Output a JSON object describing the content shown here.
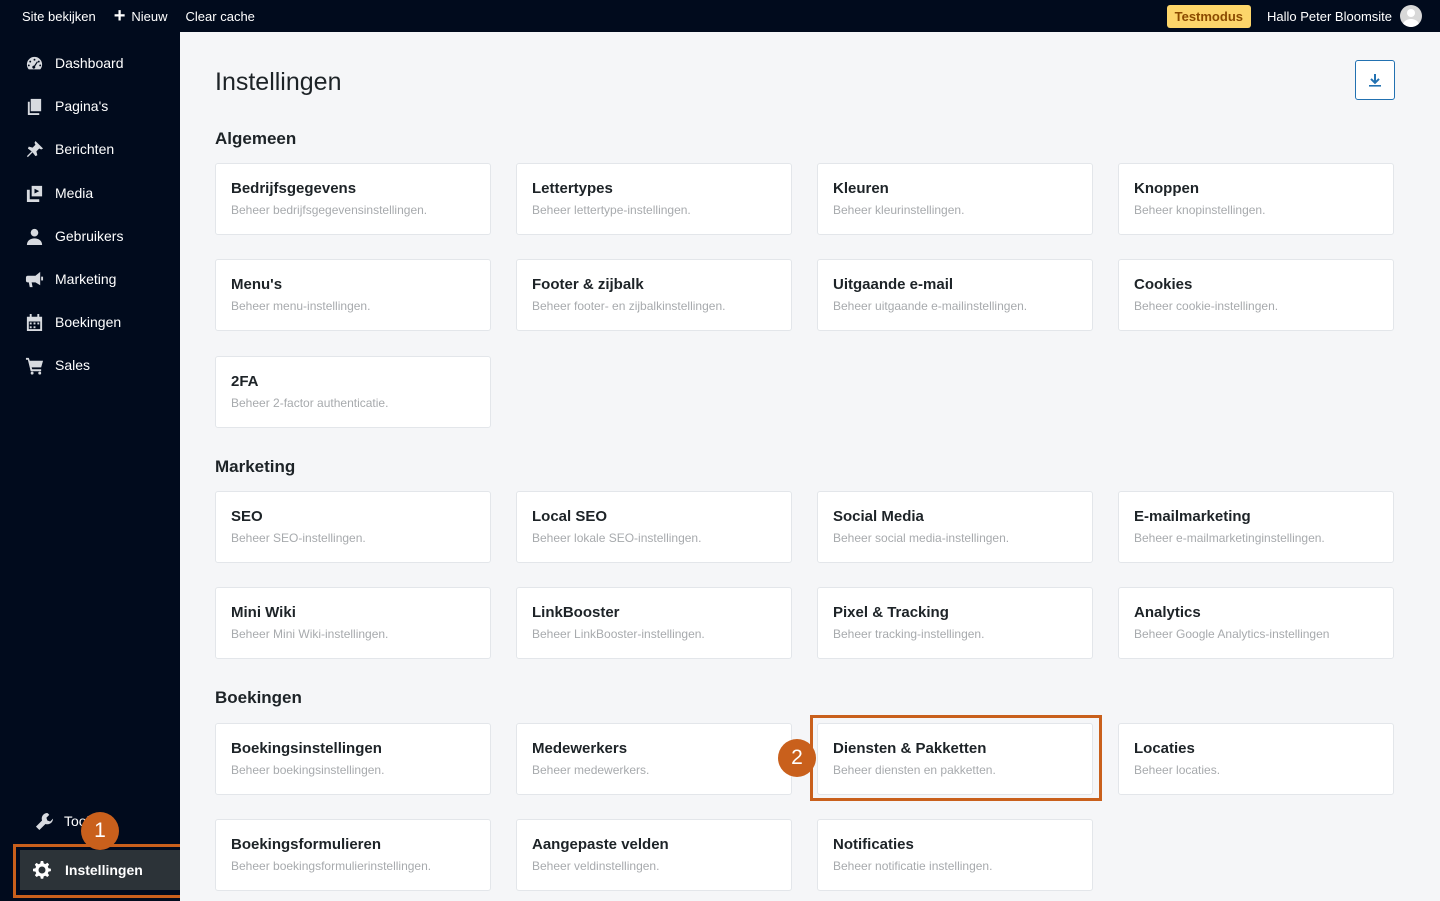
{
  "topbar": {
    "view_site": "Site bekijken",
    "new_label": "Nieuw",
    "clear_cache": "Clear cache",
    "test_mode": "Testmodus",
    "greeting": "Hallo Peter Bloomsite"
  },
  "sidebar": {
    "items": [
      {
        "label": "Dashboard",
        "icon": "dashboard-icon"
      },
      {
        "label": "Pagina's",
        "icon": "pages-icon"
      },
      {
        "label": "Berichten",
        "icon": "pin-icon"
      },
      {
        "label": "Media",
        "icon": "media-icon"
      },
      {
        "label": "Gebruikers",
        "icon": "user-icon"
      },
      {
        "label": "Marketing",
        "icon": "megaphone-icon"
      },
      {
        "label": "Boekingen",
        "icon": "calendar-icon"
      },
      {
        "label": "Sales",
        "icon": "cart-icon"
      }
    ],
    "tools_label": "Tools",
    "settings_label": "Instellingen"
  },
  "annotations": {
    "marker1": "1",
    "marker2": "2"
  },
  "main": {
    "title": "Instellingen",
    "sections": [
      {
        "title": "Algemeen",
        "cards": [
          {
            "title": "Bedrijfsgegevens",
            "desc": "Beheer bedrijfsgegevensinstellingen."
          },
          {
            "title": "Lettertypes",
            "desc": "Beheer lettertype-instellingen."
          },
          {
            "title": "Kleuren",
            "desc": "Beheer kleurinstellingen."
          },
          {
            "title": "Knoppen",
            "desc": "Beheer knopinstellingen."
          },
          {
            "title": "Menu's",
            "desc": "Beheer menu-instellingen."
          },
          {
            "title": "Footer & zijbalk",
            "desc": "Beheer footer- en zijbalkinstellingen."
          },
          {
            "title": "Uitgaande e-mail",
            "desc": "Beheer uitgaande e-mailinstellingen."
          },
          {
            "title": "Cookies",
            "desc": "Beheer cookie-instellingen."
          },
          {
            "title": "2FA",
            "desc": "Beheer 2-factor authenticatie."
          }
        ]
      },
      {
        "title": "Marketing",
        "cards": [
          {
            "title": "SEO",
            "desc": "Beheer SEO-instellingen."
          },
          {
            "title": "Local SEO",
            "desc": "Beheer lokale SEO-instellingen."
          },
          {
            "title": "Social Media",
            "desc": "Beheer social media-instellingen."
          },
          {
            "title": "E-mailmarketing",
            "desc": "Beheer e-mailmarketinginstellingen."
          },
          {
            "title": "Mini Wiki",
            "desc": "Beheer Mini Wiki-instellingen."
          },
          {
            "title": "LinkBooster",
            "desc": "Beheer LinkBooster-instellingen."
          },
          {
            "title": "Pixel & Tracking",
            "desc": "Beheer tracking-instellingen."
          },
          {
            "title": "Analytics",
            "desc": "Beheer Google Analytics-instellingen"
          }
        ]
      },
      {
        "title": "Boekingen",
        "cards": [
          {
            "title": "Boekingsinstellingen",
            "desc": "Beheer boekingsinstellingen."
          },
          {
            "title": "Medewerkers",
            "desc": "Beheer medewerkers."
          },
          {
            "title": "Diensten & Pakketten",
            "desc": "Beheer diensten en pakketten."
          },
          {
            "title": "Locaties",
            "desc": "Beheer locaties."
          },
          {
            "title": "Boekingsformulieren",
            "desc": "Beheer boekingsformulierinstellingen."
          },
          {
            "title": "Aangepaste velden",
            "desc": "Beheer veldinstellingen."
          },
          {
            "title": "Notificaties",
            "desc": "Beheer notificatie instellingen."
          }
        ]
      }
    ]
  },
  "colors": {
    "sidebar_bg": "#010b1d",
    "highlight": "#c9601c",
    "badge_bg": "#fcd56a",
    "accent": "#2271b1",
    "bell_bg": "#1e5a3c"
  }
}
